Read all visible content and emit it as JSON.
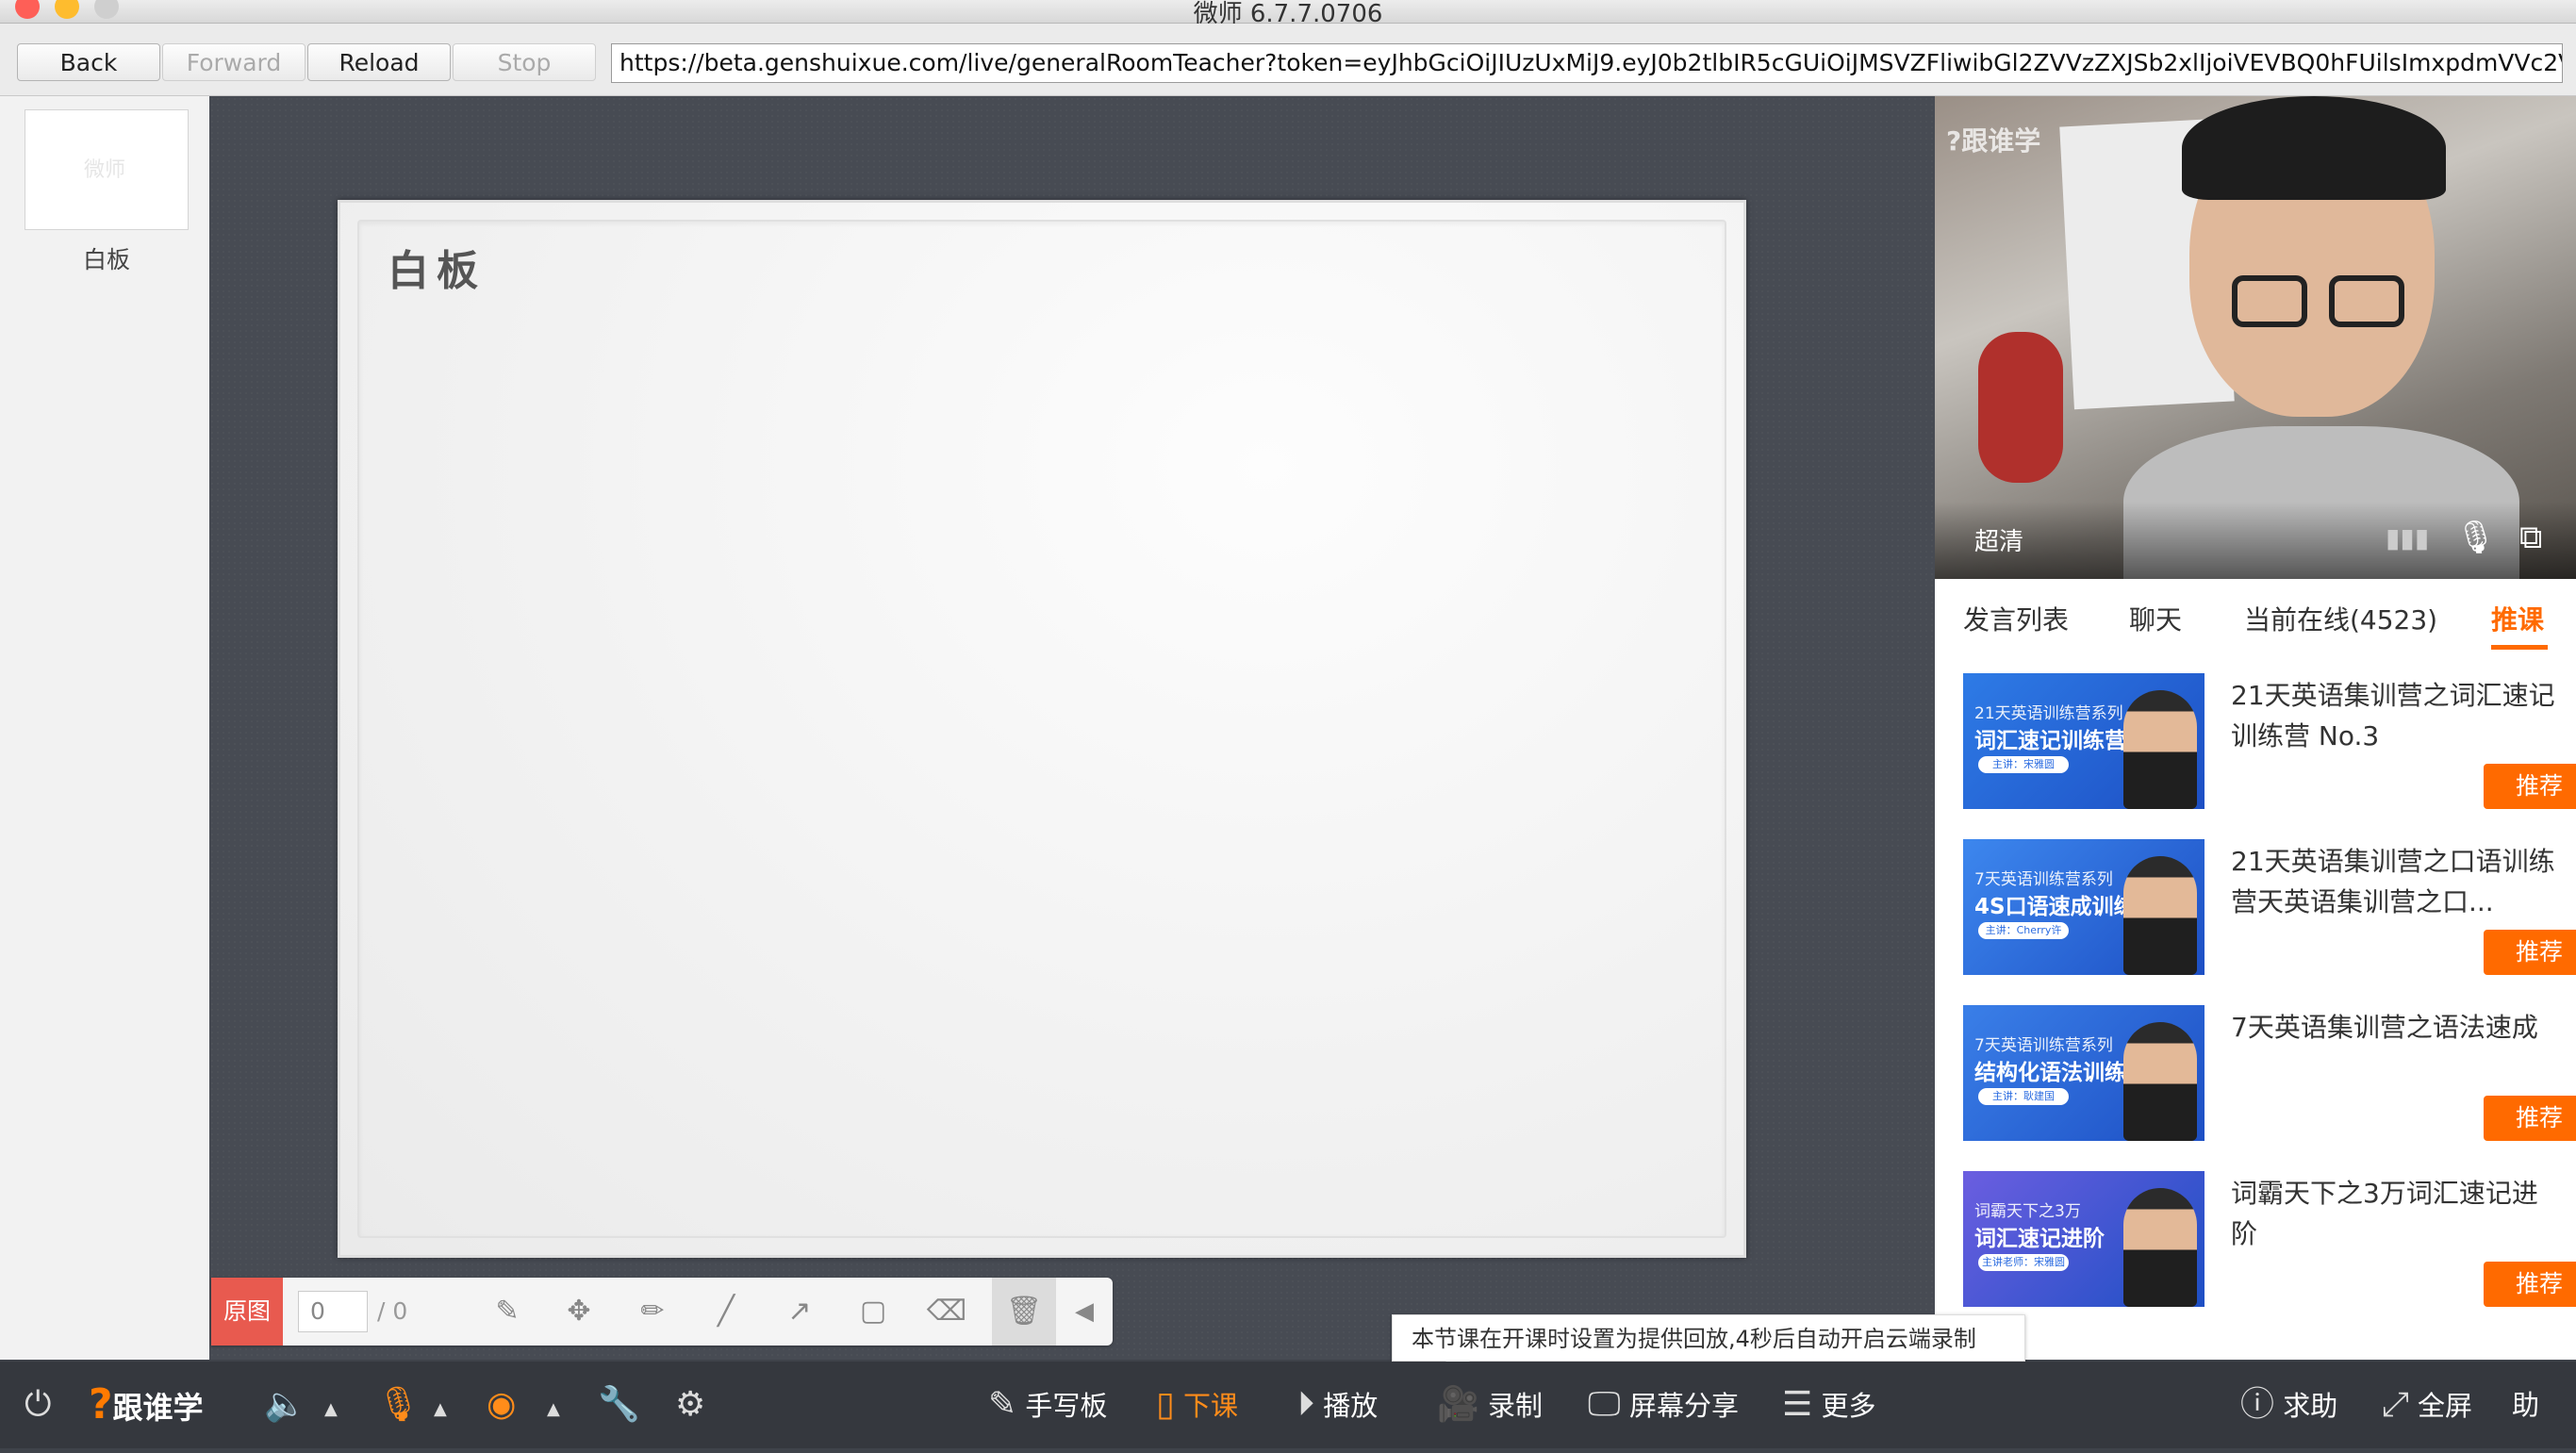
{
  "window": {
    "title": "微师 6.7.7.0706"
  },
  "nav": {
    "back": "Back",
    "forward": "Forward",
    "reload": "Reload",
    "stop": "Stop",
    "url": "https://beta.genshuixue.com/live/generalRoomTeacher?token=eyJhbGciOiJIUzUxMiJ9.eyJ0b2tlbIR5cGUiOiJMSVZFliwibGl2ZVVzZXJSb2xlIjoiVEVBQ0hFUilsImxpdmVVc2V"
  },
  "slides": {
    "thumb_logo": "微师",
    "thumb_label": "白板"
  },
  "board": {
    "title": "白板"
  },
  "pen_toolbar": {
    "original_label": "原图",
    "page_current": "0",
    "page_total": "/ 0"
  },
  "video": {
    "logo": "?跟谁学",
    "quality": "超清"
  },
  "sidebar": {
    "tabs": [
      "发言列表",
      "聊天",
      "当前在线(4523)",
      "推课"
    ],
    "active_tab": "推课",
    "courses": [
      {
        "title": "21天英语集训营之词汇速记训练营 No.3",
        "series": "21天英语训练营系列",
        "camp": "词汇速记训练营",
        "pill": "主讲：宋雅圆",
        "button": "推荐",
        "color": "#2e7be6"
      },
      {
        "title": "21天英语集训营之口语训练营天英语集训营之口...",
        "series": "7天英语训练营系列",
        "camp": "4S口语速成训练营",
        "pill": "主讲：Cherry许",
        "button": "推荐",
        "color": "#3d87ee"
      },
      {
        "title": "7天英语集训营之语法速成",
        "series": "7天英语训练营系列",
        "camp": "结构化语法训练营",
        "pill": "主讲：耿建国",
        "button": "推荐",
        "color": "#3a7fe8"
      },
      {
        "title": "词霸天下之3万词汇速记进阶",
        "series": "词霸天下之3万",
        "camp": "词汇速记进阶",
        "pill": "主讲老师：宋雅圆",
        "button": "推荐",
        "color": "#6b5ee0"
      }
    ]
  },
  "tooltip": {
    "text": "本节课在开课时设置为提供回放,4秒后自动开启云端录制"
  },
  "main_toolbar": {
    "brand": "跟谁学",
    "handwriting": "手写板",
    "end_class": "下课",
    "playback": "播放",
    "record": "录制",
    "screen_share": "屏幕分享",
    "more": "更多",
    "help": "求助",
    "fullscreen": "全屏",
    "assist": "助"
  },
  "colors": {
    "accent": "#ff6a00",
    "traffic_red": "#fe5f57",
    "traffic_yellow": "#febc2e",
    "traffic_gray": "#cfcfcf"
  }
}
